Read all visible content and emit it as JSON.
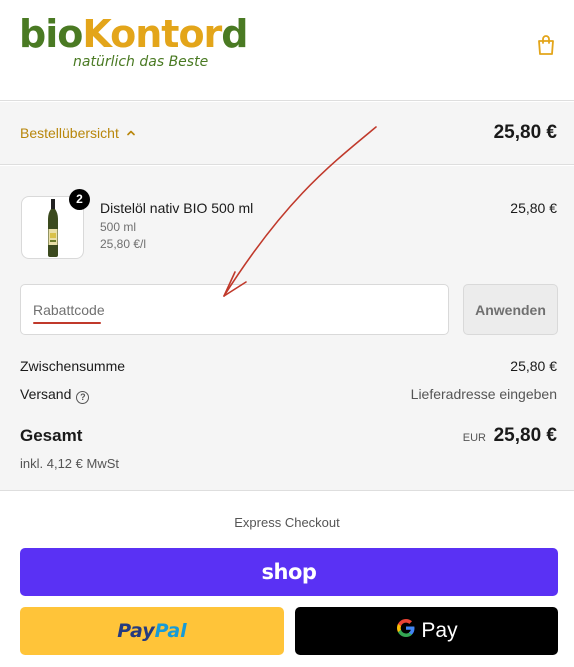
{
  "brand": {
    "name_part1": "bio",
    "name_part2": "Kontor",
    "name_part3": "d",
    "tagline": "natürlich das Beste"
  },
  "summary": {
    "toggle_label": "Bestellübersicht",
    "total": "25,80 €"
  },
  "item": {
    "quantity": "2",
    "name": "Distelöl nativ BIO 500 ml",
    "variant": "500 ml",
    "unit_price": "25,80 €/l",
    "price": "25,80 €"
  },
  "discount": {
    "placeholder": "Rabattcode",
    "apply_label": "Anwenden"
  },
  "totals": {
    "subtotal_label": "Zwischensumme",
    "subtotal_value": "25,80 €",
    "shipping_label": "Versand",
    "shipping_value": "Lieferadresse eingeben",
    "total_label": "Gesamt",
    "currency": "EUR",
    "total_value": "25,80 €",
    "tax_note": "inkl. 4,12 € MwSt"
  },
  "express": {
    "label": "Express Checkout",
    "shop_label": "shop",
    "paypal_part1": "Pay",
    "paypal_part2": "Pal",
    "gpay_g": "G",
    "gpay_label": "Pay"
  },
  "colors": {
    "brand_green": "#4a7a23",
    "brand_yellow": "#e3a51a",
    "accent_link": "#b8860b",
    "shop_purple": "#5a31f4",
    "paypal_yellow": "#ffc439",
    "annotation_red": "#c0392b"
  },
  "icons": [
    "shopping-bag-icon",
    "chevron-up-icon",
    "help-circle-icon"
  ]
}
